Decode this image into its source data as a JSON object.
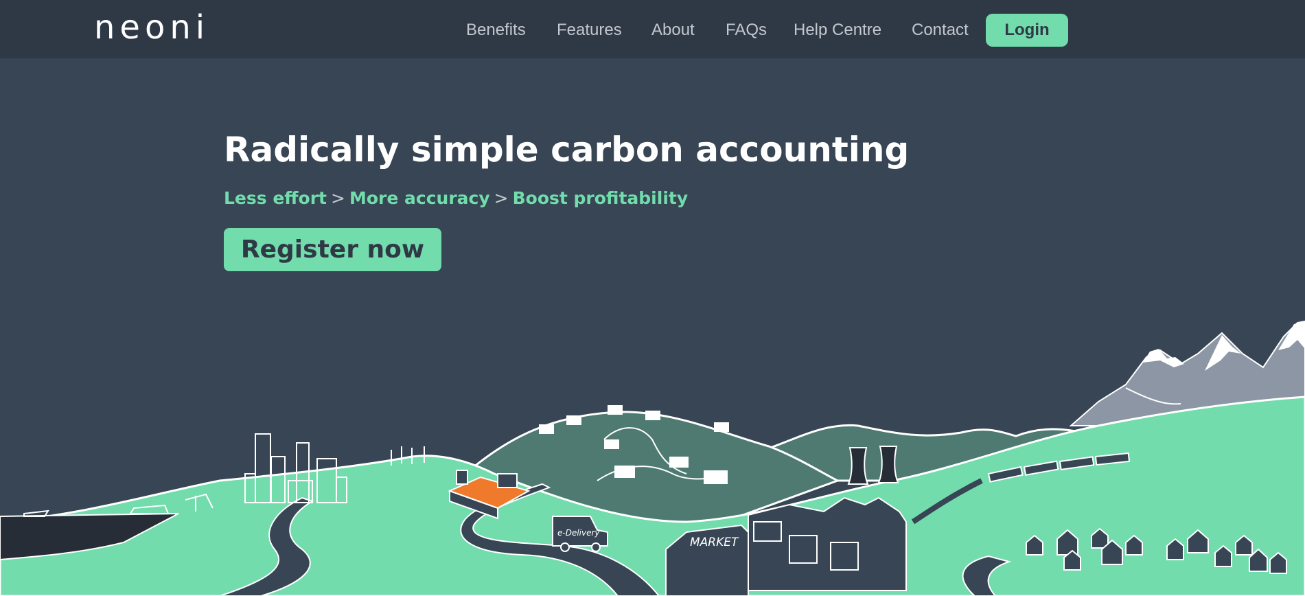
{
  "brand": {
    "logo_text": "neoni"
  },
  "nav": {
    "links": [
      "Benefits",
      "Features",
      "About",
      "FAQs",
      "Help Centre",
      "Contact"
    ],
    "login_label": "Login"
  },
  "hero": {
    "title": "Radically simple carbon accounting",
    "tagline": {
      "part1": "Less effort",
      "sep": ">",
      "part2": "More accuracy",
      "part3": "Boost profitability"
    },
    "cta_label": "Register now"
  },
  "illustration": {
    "market_sign": "MARKET",
    "truck_sign": "e-Delivery"
  },
  "colors": {
    "background": "#374554",
    "navbar": "#2f3946",
    "accent_green": "#72dcac",
    "hill_dark_green": "#4e7a72",
    "mountain_grey": "#8c96a4",
    "highlight_orange": "#f07a2c"
  }
}
